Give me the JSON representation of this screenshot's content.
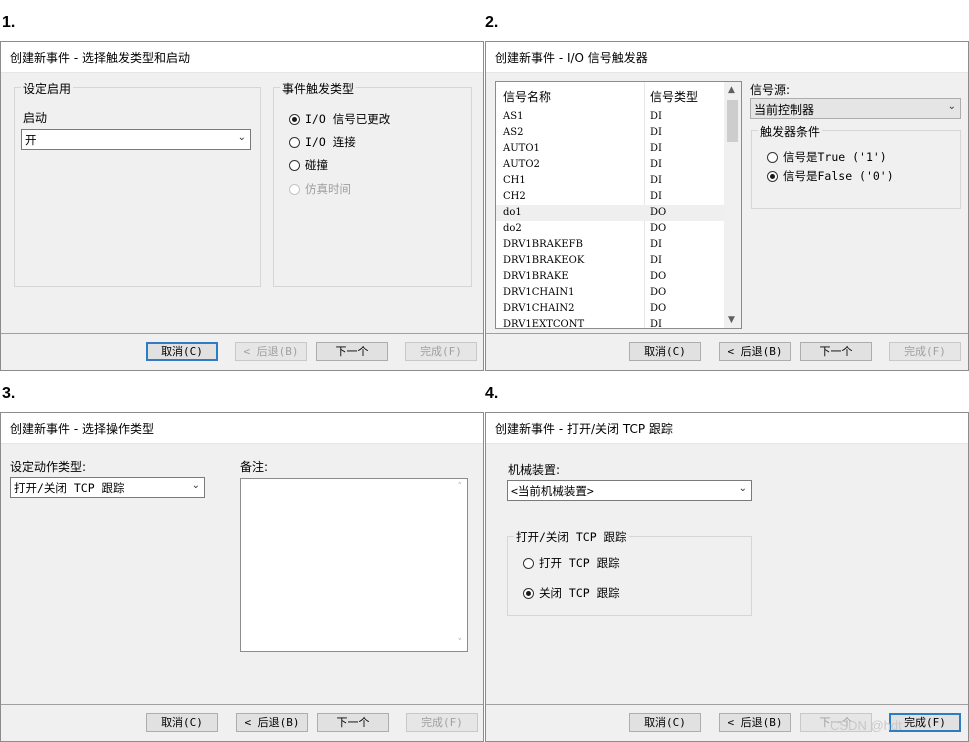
{
  "steps": [
    "1.",
    "2.",
    "3.",
    "4."
  ],
  "d1": {
    "title": "创建新事件 - 选择触发类型和启动",
    "group_enable": "设定启用",
    "start_label": "启动",
    "start_value": "开",
    "group_trigger": "事件触发类型",
    "options": [
      {
        "label": "I/O 信号已更改",
        "checked": true,
        "disabled": false
      },
      {
        "label": "I/O 连接",
        "checked": false,
        "disabled": false
      },
      {
        "label": "碰撞",
        "checked": false,
        "disabled": false
      },
      {
        "label": "仿真时间",
        "checked": false,
        "disabled": true
      }
    ]
  },
  "d2": {
    "title": "创建新事件 - I/O 信号触发器",
    "col_name": "信号名称",
    "col_type": "信号类型",
    "rows": [
      [
        "AS1",
        "DI"
      ],
      [
        "AS2",
        "DI"
      ],
      [
        "AUTO1",
        "DI"
      ],
      [
        "AUTO2",
        "DI"
      ],
      [
        "CH1",
        "DI"
      ],
      [
        "CH2",
        "DI"
      ],
      [
        "do1",
        "DO"
      ],
      [
        "do2",
        "DO"
      ],
      [
        "DRV1BRAKEFB",
        "DI"
      ],
      [
        "DRV1BRAKEOK",
        "DI"
      ],
      [
        "DRV1BRAKE",
        "DO"
      ],
      [
        "DRV1CHAIN1",
        "DO"
      ],
      [
        "DRV1CHAIN2",
        "DO"
      ],
      [
        "DRV1EXTCONT",
        "DI"
      ]
    ],
    "selected_row": 6,
    "source_label": "信号源:",
    "source_value": "当前控制器",
    "cond_group": "触发器条件",
    "cond_true": "信号是True ('1')",
    "cond_false": "信号是False ('0')",
    "cond_selected": "false"
  },
  "d3": {
    "title": "创建新事件 - 选择操作类型",
    "action_label": "设定动作类型:",
    "action_value": "打开/关闭 TCP 跟踪",
    "notes_label": "备注:"
  },
  "d4": {
    "title": "创建新事件 - 打开/关闭 TCP 跟踪",
    "mech_label": "机械装置:",
    "mech_value": "<当前机械装置>",
    "group": "打开/关闭 TCP 跟踪",
    "opt_on": "打开 TCP 跟踪",
    "opt_off": "关闭 TCP 跟踪",
    "selected": "off"
  },
  "buttons": {
    "cancel": "取消(C)",
    "back": "< 后退(B)",
    "next": "下一个",
    "finish": "完成(F)"
  },
  "watermark": "CSDN @hdt"
}
